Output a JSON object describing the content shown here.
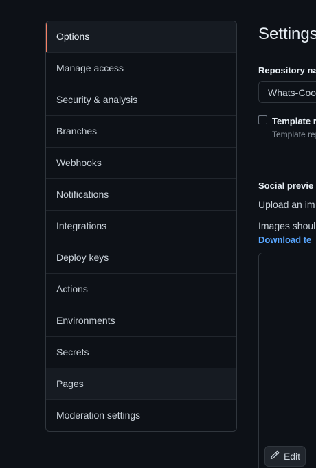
{
  "sidebar": {
    "items": [
      {
        "label": "Options"
      },
      {
        "label": "Manage access"
      },
      {
        "label": "Security & analysis"
      },
      {
        "label": "Branches"
      },
      {
        "label": "Webhooks"
      },
      {
        "label": "Notifications"
      },
      {
        "label": "Integrations"
      },
      {
        "label": "Deploy keys"
      },
      {
        "label": "Actions"
      },
      {
        "label": "Environments"
      },
      {
        "label": "Secrets"
      },
      {
        "label": "Pages"
      },
      {
        "label": "Moderation settings"
      }
    ],
    "selected": "Options",
    "hovered": "Pages"
  },
  "main": {
    "title": "Settings",
    "repo_name_label": "Repository na",
    "repo_name_value": "Whats-Coo",
    "template_label": "Template r",
    "template_desc": "Template rep",
    "social_preview_label": "Social previe",
    "upload_text": "Upload an im",
    "images_text": "Images shoul",
    "download_link": "Download te",
    "edit_button": "Edit"
  },
  "colors": {
    "accent_selected": "#f78166",
    "link": "#58a6ff",
    "background": "#0d1117"
  }
}
